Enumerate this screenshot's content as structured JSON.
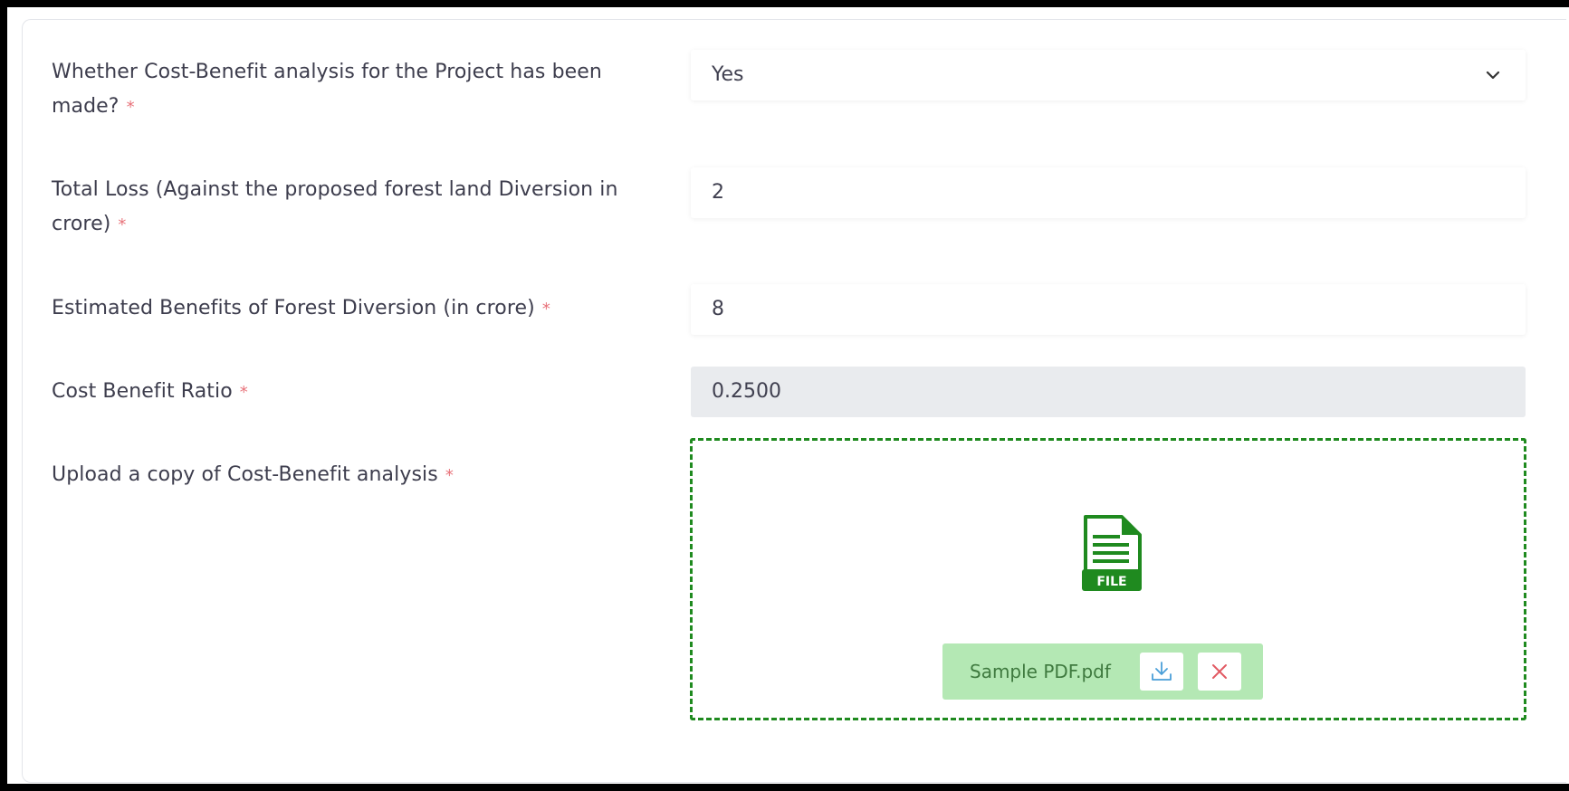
{
  "form": {
    "required_marker": "*",
    "rows": [
      {
        "label": "Whether Cost-Benefit analysis for the Project has been made?",
        "value": "Yes",
        "type": "select"
      },
      {
        "label": "Total Loss (Against the proposed forest land Diversion in crore)",
        "value": "2",
        "type": "input"
      },
      {
        "label": "Estimated Benefits of Forest Diversion (in crore)",
        "value": "8",
        "type": "input"
      },
      {
        "label": "Cost Benefit Ratio",
        "value": "0.2500",
        "type": "readonly"
      }
    ],
    "upload": {
      "label": "Upload a copy of Cost-Benefit analysis",
      "file_icon": "file-icon",
      "file_icon_text": "FILE",
      "file_name": "Sample PDF.pdf",
      "download_icon": "download-icon",
      "remove_icon": "close-icon"
    }
  },
  "colors": {
    "accent_green": "#1f8a1f",
    "chip_background": "#b4e8b4",
    "required_red": "#e8727a",
    "readonly_background": "#e9ebee"
  }
}
